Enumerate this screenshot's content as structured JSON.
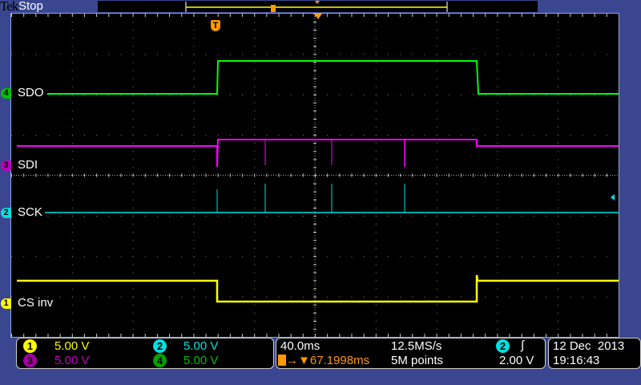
{
  "header": {
    "brand": "Tek",
    "status": "Stop"
  },
  "channels": [
    {
      "num": "1",
      "label": "CS inv",
      "scale": "5.00 V",
      "color": "#ffff00"
    },
    {
      "num": "2",
      "label": "SCK",
      "scale": "5.00 V",
      "color": "#00e0e0"
    },
    {
      "num": "3",
      "label": "SDI",
      "scale": "5.00 V",
      "color": "#c000c0"
    },
    {
      "num": "4",
      "label": "SDO",
      "scale": "5.00 V",
      "color": "#00c000"
    }
  ],
  "trigger_marker": "T",
  "horizontal": {
    "timebase": "40.0ms",
    "trigger_offset": "67.1998ms",
    "sample_rate": "12.5MS/s",
    "record_length": "5M points"
  },
  "trigger": {
    "source": "2",
    "slope": "rising",
    "level": "2.00 V"
  },
  "datetime": {
    "date": "12 Dec  2013",
    "time": "19:16:43"
  }
}
